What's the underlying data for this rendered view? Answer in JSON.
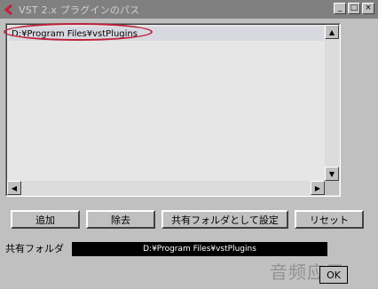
{
  "window": {
    "title": "VST 2.x プラグインのパス",
    "minimize_glyph": "_",
    "maximize_glyph": "□",
    "close_glyph": "×"
  },
  "path_list": {
    "items": [
      {
        "label": "D:¥Program Files¥vstPlugins",
        "selected": true
      }
    ]
  },
  "buttons": {
    "add": "追加",
    "remove": "除去",
    "set_shared": "共有フォルダとして設定",
    "reset": "リセット",
    "ok": "OK"
  },
  "shared_folder": {
    "label": "共有フォルダ",
    "value": "D:¥Program Files¥vstPlugins"
  },
  "watermark": "音频应用",
  "colors": {
    "highlight_ellipse": "#c0203a",
    "shared_field_bg": "#000000"
  }
}
